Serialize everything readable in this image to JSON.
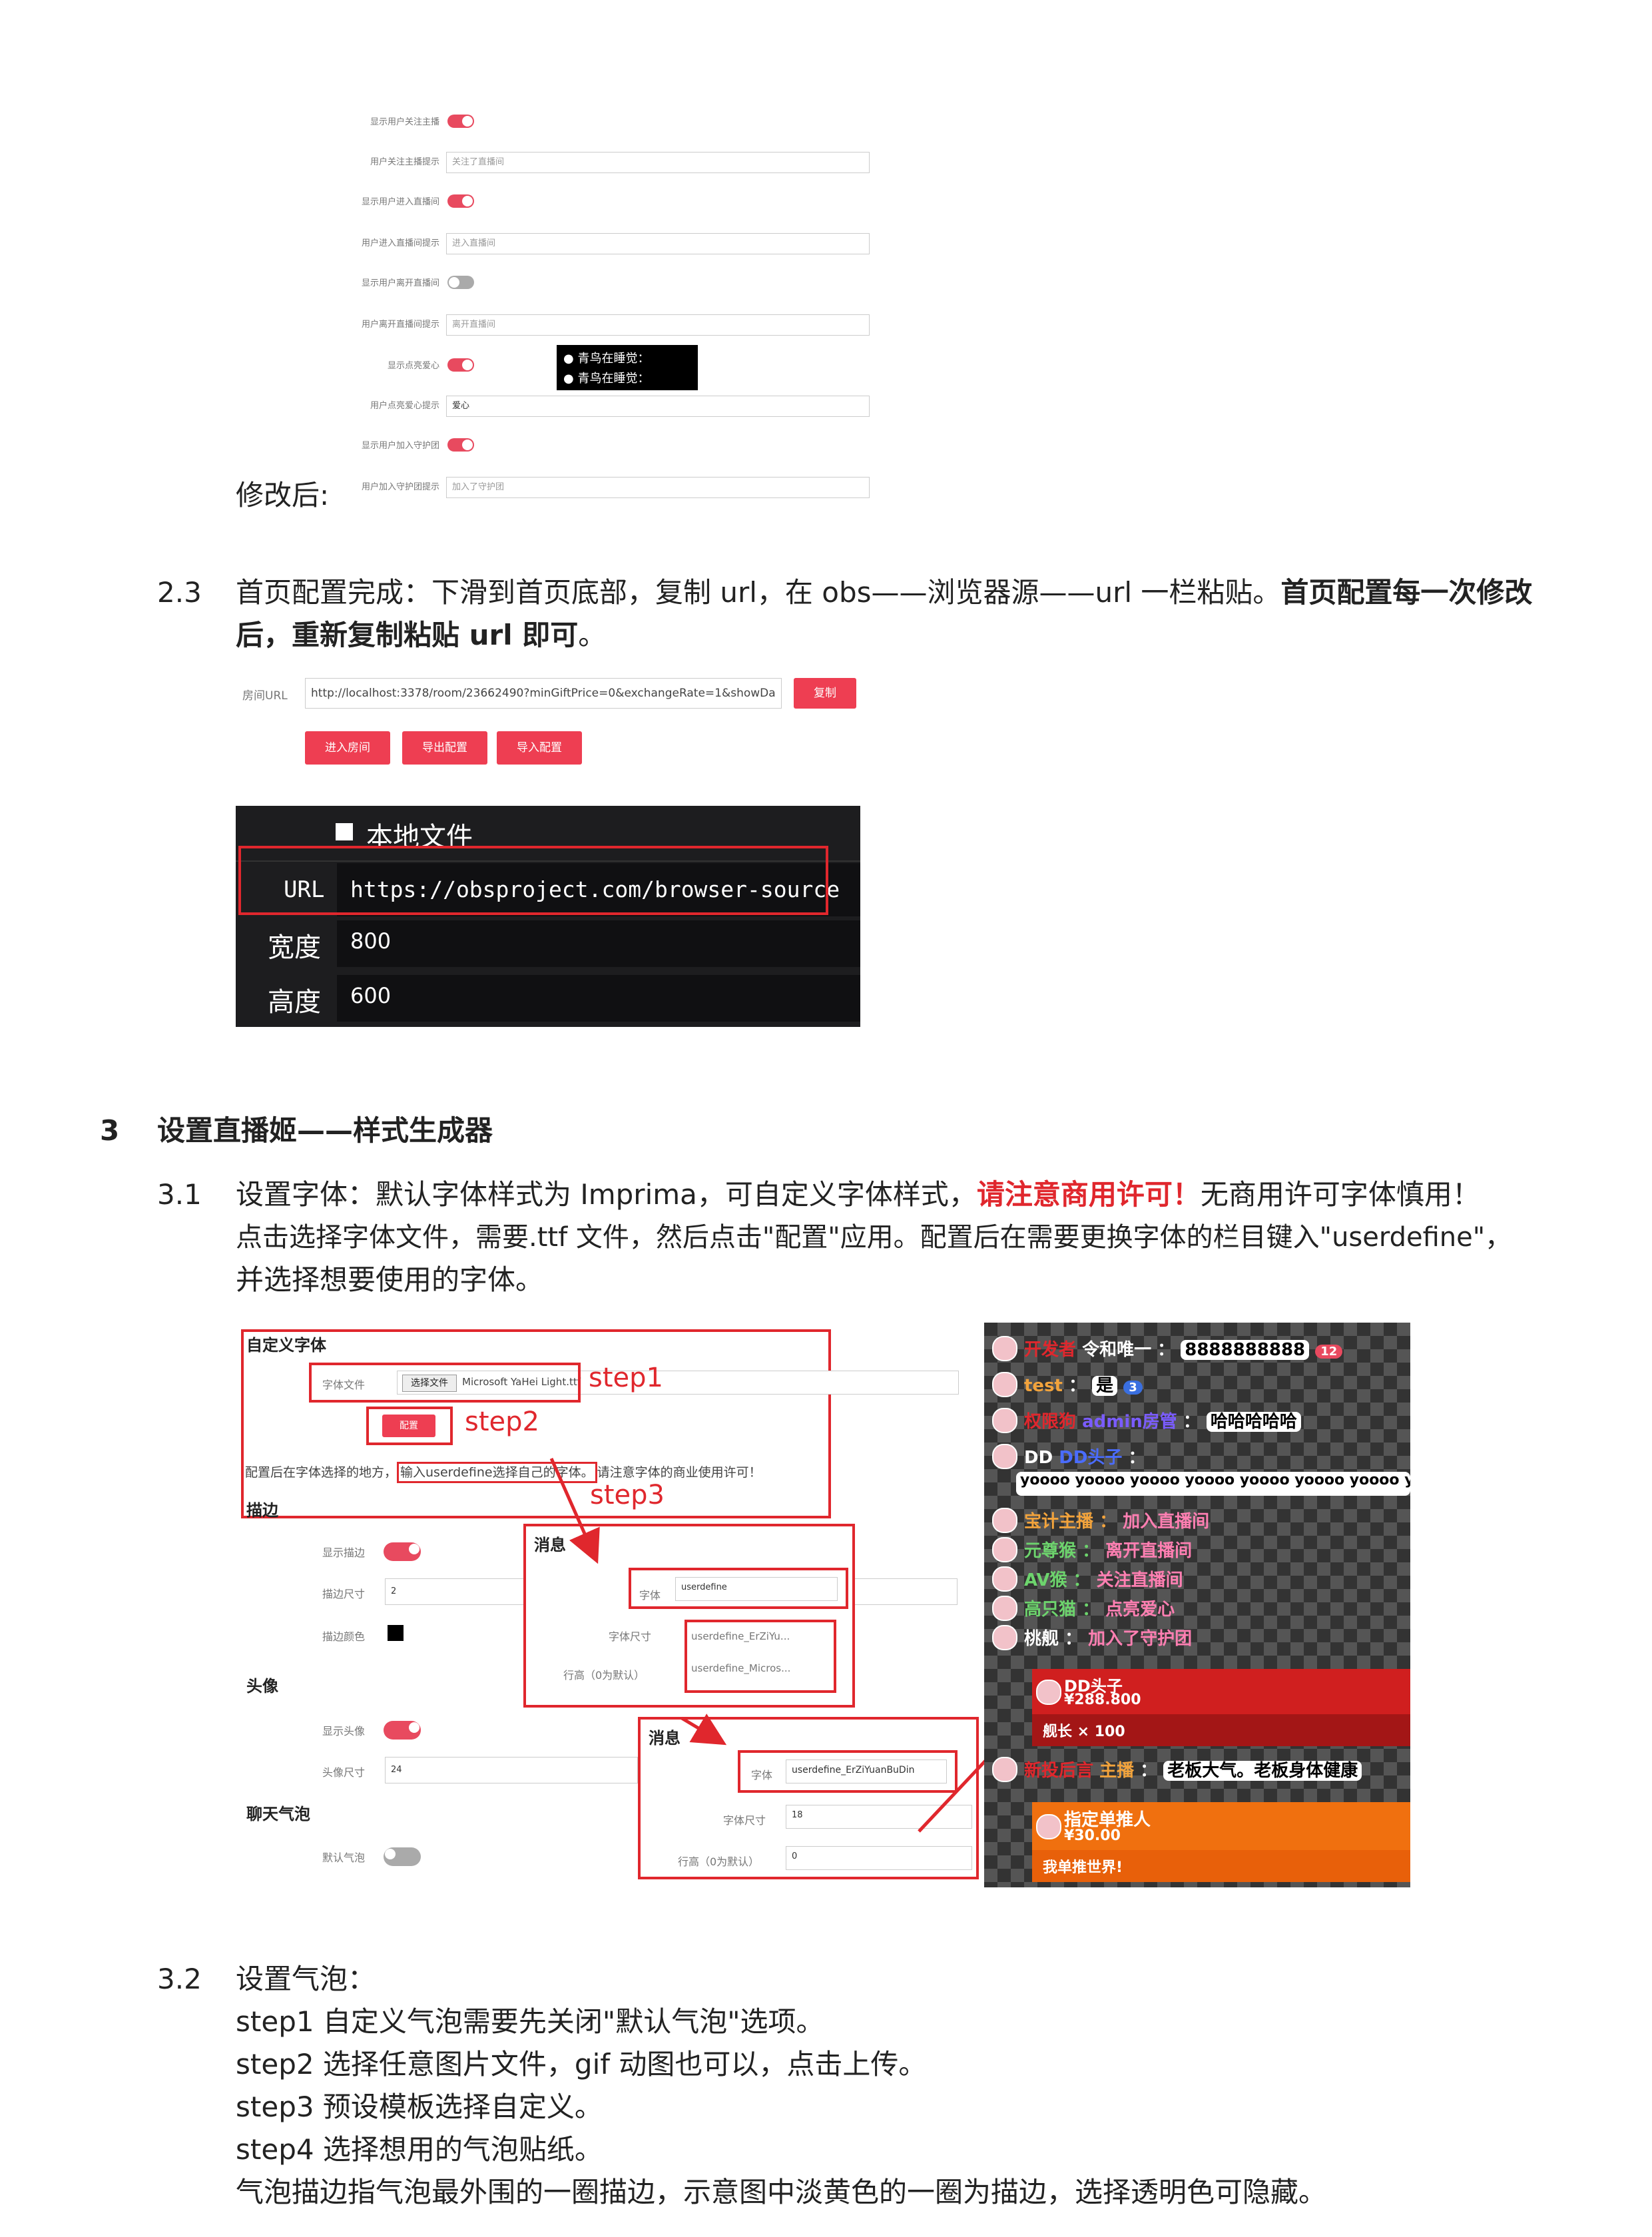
{
  "settings_panel": {
    "rows": [
      {
        "label": "显示用户关注主播",
        "type": "toggle",
        "on": true
      },
      {
        "label": "用户关注主播提示",
        "type": "input",
        "placeholder": "关注了直播间"
      },
      {
        "label": "显示用户进入直播间",
        "type": "toggle",
        "on": true
      },
      {
        "label": "用户进入直播间提示",
        "type": "input",
        "placeholder": "进入直播间"
      },
      {
        "label": "显示用户离开直播间",
        "type": "toggle",
        "on": false
      },
      {
        "label": "用户离开直播间提示",
        "type": "input",
        "placeholder": "离开直播间"
      },
      {
        "label": "显示点亮爱心",
        "type": "toggle",
        "on": true
      },
      {
        "label": "用户点亮爱心提示",
        "type": "input",
        "value": "爱心"
      },
      {
        "label": "显示用户加入守护团",
        "type": "toggle",
        "on": true
      },
      {
        "label": "用户加入守护团提示",
        "type": "input",
        "placeholder": "加入了守护团"
      }
    ],
    "preview_lines": [
      "青鸟在睡觉：",
      "青鸟在睡觉："
    ],
    "modified_label": "修改后:"
  },
  "section_2_3": {
    "number": "2.3",
    "text_normal": "首页配置完成：下滑到首页底部，复制 url，在 obs——浏览器源——url 一栏粘贴。",
    "text_bold_1": "首页配置每一次修改",
    "text_bold_2": "后，重新复制粘贴 url 即可",
    "text_end": "。",
    "room_url_label": "房间URL",
    "room_url_value": "http://localhost:3378/room/23662490?minGiftPrice=0&exchangeRate=1&showDa",
    "copy_button": "复制",
    "enter_room_button": "进入房间",
    "export_button": "导出配置",
    "import_button": "导入配置"
  },
  "obs_panel": {
    "local_file_label": "本地文件",
    "url_label": "URL",
    "url_value": "https://obsproject.com/browser-source",
    "width_label": "宽度",
    "width_value": "800",
    "height_label": "高度",
    "height_value": "600"
  },
  "section_3": {
    "number": "3",
    "title": "设置直播姬——样式生成器"
  },
  "section_3_1": {
    "number": "3.1",
    "line1_a": "设置字体：默认字体样式为 Imprima，可自定义字体样式，",
    "line1_red": "请注意商用许可！",
    "line1_b": "无商用许可字体慎用！",
    "line2": "点击选择字体文件，需要.ttf 文件，然后点击\"配置\"应用。配置后在需要更换字体的栏目键入\"userdefine\"，",
    "line3": "并选择想要使用的字体。"
  },
  "font_panel": {
    "custom_font_title": "自定义字体",
    "font_file_label": "字体文件",
    "choose_file_btn": "选择文件",
    "file_name": "Microsoft YaHei Light.ttf",
    "step1": "step1",
    "config_btn": "配置",
    "step2": "step2",
    "note_a": "配置后在字体选择的地方，",
    "note_box": "输入userdefine选择自己的字体。",
    "note_b": "请注意字体的商业使用许可！",
    "step3": "step3",
    "stroke_title": "描边",
    "show_stroke": "显示描边",
    "stroke_size": "描边尺寸",
    "stroke_size_val": "2",
    "stroke_color": "描边颜色",
    "avatar_title": "头像",
    "show_avatar": "显示头像",
    "avatar_size": "头像尺寸",
    "avatar_size_val": "24",
    "bubble_title": "聊天气泡",
    "default_bubble": "默认气泡"
  },
  "msg_popup1": {
    "title": "消息",
    "font_label": "字体",
    "font_value": "userdefine",
    "font_size_label": "字体尺寸",
    "line_height_label": "行高（0为默认）",
    "options": [
      "userdefine_ErZiYu...",
      "userdefine_Micros..."
    ]
  },
  "msg_popup2": {
    "title": "消息",
    "font_label": "字体",
    "font_value": "userdefine_ErZiYuanBuDin",
    "font_size_label": "字体尺寸",
    "font_size_value": "18",
    "line_height_label": "行高（0为默认）",
    "line_height_value": "0"
  },
  "danmaku_preview": {
    "rows": [
      {
        "user": "开发者",
        "name": "令和唯一",
        "sep": "：",
        "msg": "8888888888",
        "badge": "12"
      },
      {
        "user": "test",
        "name": "",
        "sep": "：",
        "msg": "是",
        "badge": "3"
      },
      {
        "user": "权限狗",
        "name": "admin房管",
        "sep": "：",
        "msg": "哈哈哈哈哈"
      },
      {
        "user": "DD",
        "name": "DD头子",
        "sep": "：",
        "msg": ""
      },
      {
        "user": "",
        "name": "",
        "sep": "",
        "msg": "yoooo yoooo yoooo yoooo yoooo yoooo yoooo yoooo yoooo"
      },
      {
        "user": "宝计主播",
        "name": "",
        "sep": "：",
        "msg": "加入直播间"
      },
      {
        "user": "元尊猴",
        "name": "",
        "sep": "：",
        "msg": "离开直播间"
      },
      {
        "user": "AV猴",
        "name": "",
        "sep": "：",
        "msg": "关注直播间"
      },
      {
        "user": "高只猫",
        "name": "",
        "sep": "：",
        "msg": "点亮爱心"
      },
      {
        "user": "桃舰",
        "name": "",
        "sep": "：",
        "msg": "加入了守护团"
      }
    ],
    "sc1_name": "DD头子",
    "sc1_price": "¥288.800",
    "sc1_msg": "舰长 × 100",
    "mid_user": "新投后言",
    "mid_name": "主播",
    "mid_msg": "老板大气。老板身体健康",
    "sc2_name": "指定单推人",
    "sc2_price": "¥30.00",
    "sc2_msg": "我单推世界!"
  },
  "section_3_2": {
    "number": "3.2",
    "lines": [
      "设置气泡：",
      "step1 自定义气泡需要先关闭\"默认气泡\"选项。",
      "step2 选择任意图片文件，gif 动图也可以，点击上传。",
      "step3 预设模板选择自定义。",
      "step4 选择想用的气泡贴纸。",
      "气泡描边指气泡最外围的一圈描边，示意图中淡黄色的一圈为描边，选择透明色可隐藏。"
    ]
  }
}
